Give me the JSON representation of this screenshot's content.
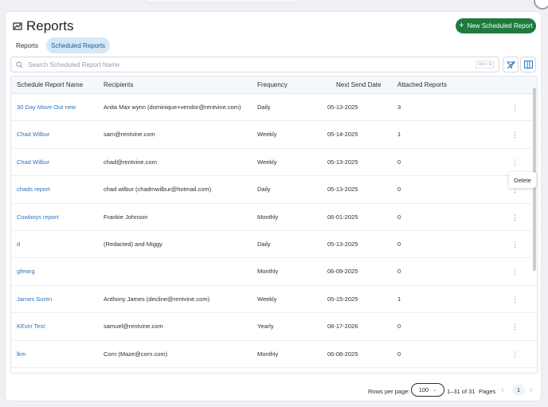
{
  "page": {
    "title": "Reports",
    "new_button_label": "New Scheduled Report",
    "accent_color": "#1f7a3d"
  },
  "tabs": [
    {
      "label": "Reports",
      "active": false
    },
    {
      "label": "Scheduled Reports",
      "active": true
    }
  ],
  "search": {
    "placeholder": "Search Scheduled Report Name",
    "shortcut": "Ctrl + S"
  },
  "table": {
    "columns": [
      "Schedule Report Name",
      "Recipients",
      "Frequency",
      "Next Send Date",
      "Attached Reports"
    ],
    "rows": [
      {
        "name": "30 Day Move Out new",
        "recipients": "Anita Max wynn (dominique+vendor@rentvine.com)",
        "frequency": "Daily",
        "next_send": "05-13-2025",
        "attached": "3"
      },
      {
        "name": "Chad Wilbur",
        "recipients": "sam@rentvine.com",
        "frequency": "Weekly",
        "next_send": "05-14-2025",
        "attached": "1"
      },
      {
        "name": "Chad Wilbur",
        "recipients": "chad@rentvine.com",
        "frequency": "Weekly",
        "next_send": "05-13-2025",
        "attached": "0"
      },
      {
        "name": "chads report",
        "recipients": "chad wilbur (chadmwilbur@hotmail.com)",
        "frequency": "Daily",
        "next_send": "05-13-2025",
        "attached": "0"
      },
      {
        "name": "Cowboys report",
        "recipients": "Frankie Johnson",
        "frequency": "Monthly",
        "next_send": "06-01-2025",
        "attached": "0"
      },
      {
        "name": "d",
        "recipients": "(Redacted) and Miggy",
        "frequency": "Daily",
        "next_send": "05-13-2025",
        "attached": "0"
      },
      {
        "name": "gfewrg",
        "recipients": "",
        "frequency": "Monthly",
        "next_send": "06-09-2025",
        "attached": "0"
      },
      {
        "name": "James Suren",
        "recipients": "Anthony James (decline@rentvine.com)",
        "frequency": "Weekly",
        "next_send": "05-15-2025",
        "attached": "1"
      },
      {
        "name": "KEvin Test",
        "recipients": "samuel@rentvine.com",
        "frequency": "Yearly",
        "next_send": "08-17-2026",
        "attached": "0"
      },
      {
        "name": "lkm",
        "recipients": "Corn (Maze@corn.com)",
        "frequency": "Monthly",
        "next_send": "06-08-2025",
        "attached": "0"
      }
    ]
  },
  "context_menu": {
    "delete_label": "Delete"
  },
  "pagination": {
    "rows_per_page_label": "Rows per page:",
    "rows_per_page": "100",
    "range": "1–31 of 31",
    "pages_label": "Pages",
    "current_page": "1"
  }
}
